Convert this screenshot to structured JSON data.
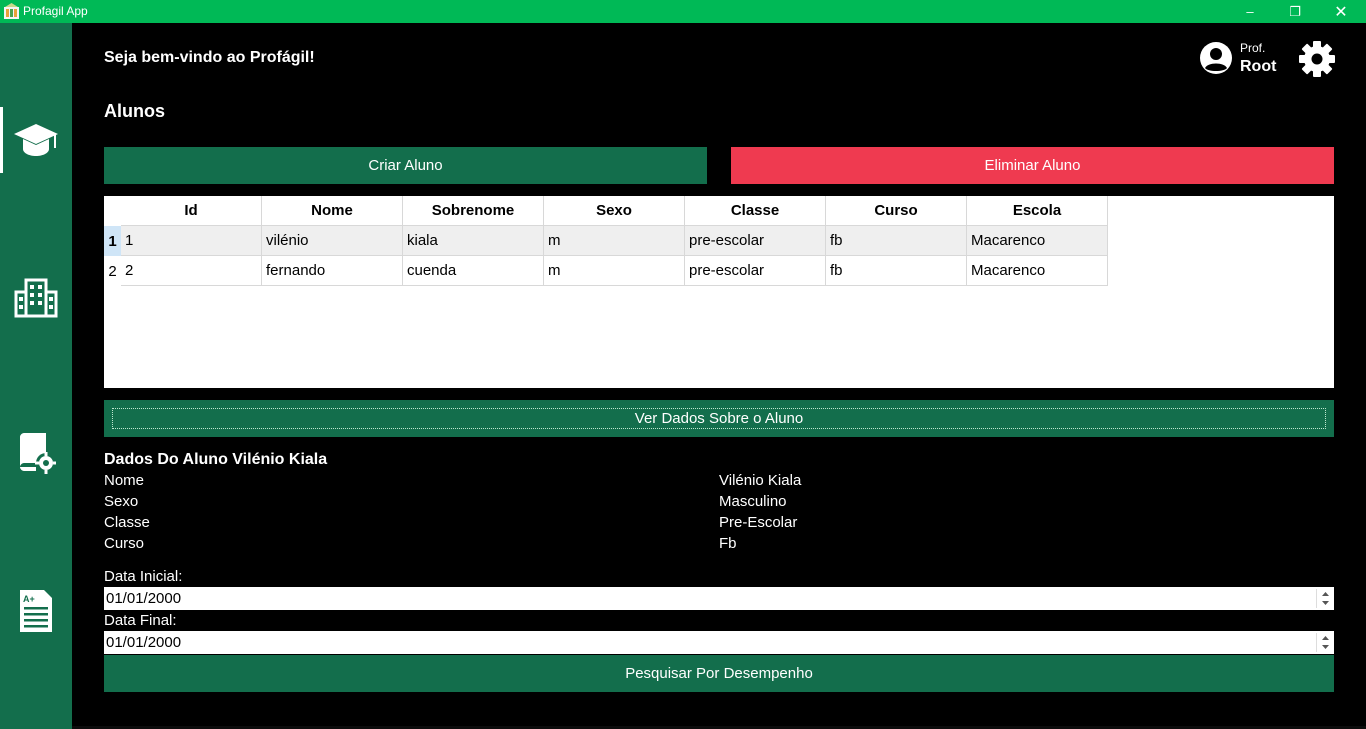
{
  "window": {
    "title": "Profagil App",
    "controls": {
      "minimize": "–",
      "maximize": "❐",
      "close": "✕"
    }
  },
  "sidebar": {
    "items": [
      {
        "icon": "graduation-cap-icon",
        "active": true
      },
      {
        "icon": "building-icon",
        "active": false
      },
      {
        "icon": "book-settings-icon",
        "active": false
      },
      {
        "icon": "report-card-icon",
        "active": false
      }
    ]
  },
  "header": {
    "welcome": "Seja bem-vindo ao Profágil!",
    "user_prefix": "Prof.",
    "user_name": "Root"
  },
  "page": {
    "title": "Alunos",
    "create_label": "Criar Aluno",
    "delete_label": "Eliminar Aluno",
    "view_label": "Ver Dados Sobre o Aluno",
    "search_label": "Pesquisar Por Desempenho"
  },
  "table": {
    "columns": [
      "Id",
      "Nome",
      "Sobrenome",
      "Sexo",
      "Classe",
      "Curso",
      "Escola"
    ],
    "row_numbers": [
      "1",
      "2"
    ],
    "rows": [
      [
        "1",
        "vilénio",
        "kiala",
        "m",
        "pre-escolar",
        "fb",
        "Macarenco"
      ],
      [
        "2",
        "fernando",
        "cuenda",
        "m",
        "pre-escolar",
        "fb",
        "Macarenco"
      ]
    ],
    "selected_row": 1
  },
  "details": {
    "title": "Dados Do Aluno Vilénio Kiala",
    "labels": [
      "Nome",
      "Sexo",
      "Classe",
      "Curso"
    ],
    "values": [
      "Vilénio Kiala",
      "Masculino",
      "Pre-Escolar",
      "Fb"
    ]
  },
  "form": {
    "start_label": "Data Inicial:",
    "start_value": "01/01/2000",
    "end_label": "Data Final:",
    "end_value": "01/01/2000"
  },
  "colors": {
    "titlebar": "#00b956",
    "sidebar": "#136e4c",
    "primary": "#136e4c",
    "danger": "#ef3a50"
  }
}
